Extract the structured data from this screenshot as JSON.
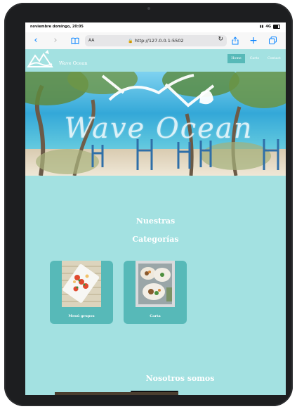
{
  "status_bar": {
    "time_date": "noviembre domingo, 20:05",
    "network": "4G"
  },
  "browser": {
    "text_size_label": "AA",
    "url": "http://127.0.0.1:5502"
  },
  "site": {
    "title": "Wave Ocean",
    "nav": [
      {
        "label": "Home",
        "active": true
      },
      {
        "label": "Carts",
        "active": false
      },
      {
        "label": "Contact",
        "active": false
      }
    ],
    "hero_script_text": "Wave Ocean"
  },
  "categories_section": {
    "title_line1": "Nuestras",
    "title_line2": "Categorías",
    "cards": [
      {
        "label": "Menú grupos"
      },
      {
        "label": "Carta"
      }
    ]
  },
  "about_section": {
    "title": "Nosotros somos"
  },
  "colors": {
    "page_bg": "#a3e1e1",
    "accent": "#57b9b8",
    "browser_blue": "#0a84ff",
    "device_frame": "#1d1e20"
  }
}
